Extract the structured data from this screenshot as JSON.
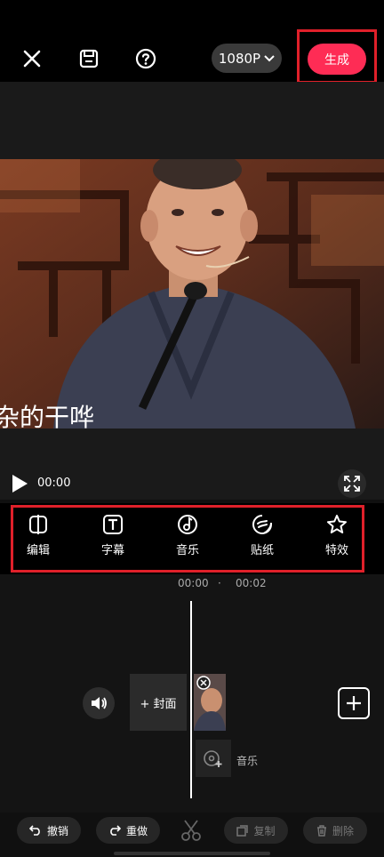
{
  "header": {
    "close_icon": "close-icon",
    "save_icon": "save-icon",
    "help_icon": "help-icon",
    "resolution": "1080P",
    "generate_label": "生成"
  },
  "preview": {
    "time": "00:00",
    "subtitle_fragment": "杂的干哗",
    "fullscreen_icon": "fullscreen-icon"
  },
  "tools": [
    {
      "label": "编辑",
      "icon": "edit-split-icon"
    },
    {
      "label": "字幕",
      "icon": "text-icon"
    },
    {
      "label": "音乐",
      "icon": "music-note-icon"
    },
    {
      "label": "贴纸",
      "icon": "sticker-icon"
    },
    {
      "label": "特效",
      "icon": "effects-star-icon"
    }
  ],
  "timeline": {
    "time_current": "00:00",
    "time_dot": "·",
    "time_next": "00:02",
    "cover_label": "+ 封面",
    "music_label": "音乐"
  },
  "bottom": {
    "undo": "撤销",
    "redo": "重做",
    "copy": "复制",
    "delete": "删除"
  },
  "colors": {
    "accent": "#fe2c55",
    "highlight_box": "#e0202a"
  }
}
